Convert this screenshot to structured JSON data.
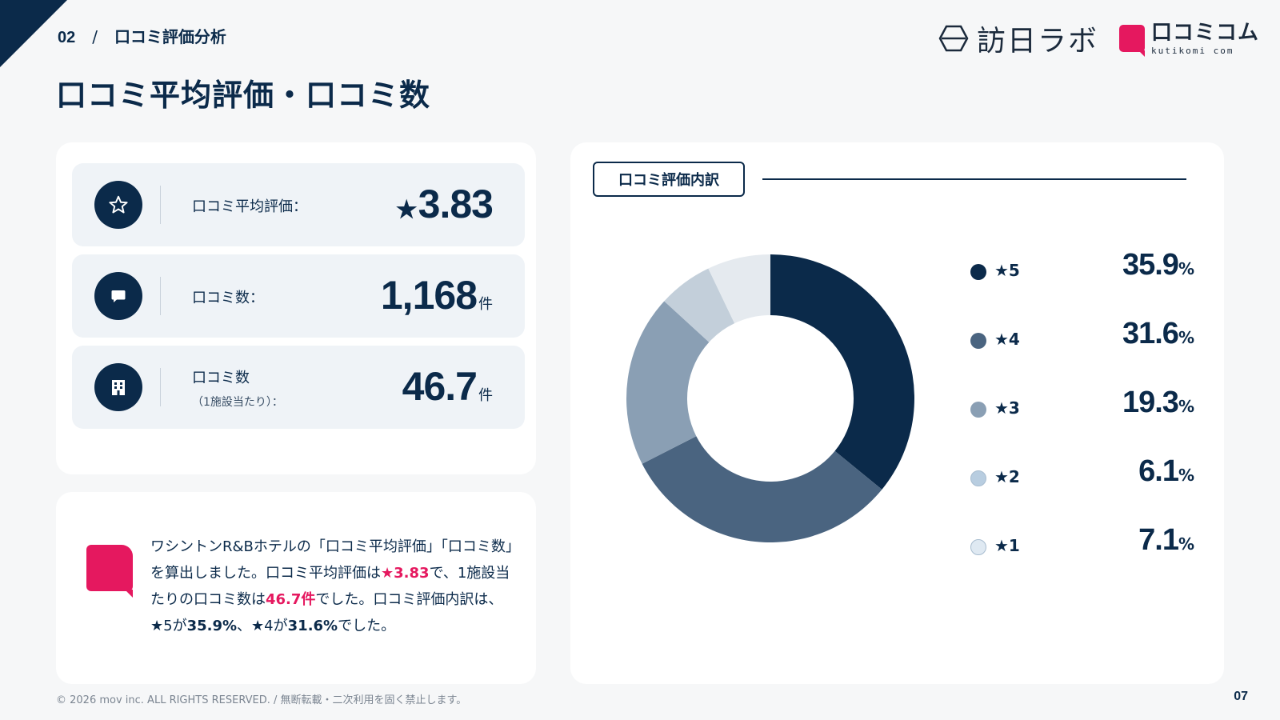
{
  "header": {
    "section_number": "02",
    "separator": "/",
    "section_title": "口コミ評価分析",
    "page_title": "口コミ平均評価・口コミ数",
    "logo1_text": "訪日ラボ",
    "logo2_text": "口コミコム",
    "logo2_sub": "kutikomi com"
  },
  "stats": [
    {
      "label": "口コミ平均評価：",
      "prefix": "★",
      "value": "3.83",
      "unit": "",
      "icon": "star-icon"
    },
    {
      "label": "口コミ数：",
      "prefix": "",
      "value": "1,168",
      "unit": "件",
      "icon": "chat-icon"
    },
    {
      "label": "口コミ数",
      "sub": "（1施設当たり）：",
      "prefix": "",
      "value": "46.7",
      "unit": "件",
      "icon": "building-icon"
    }
  ],
  "note": {
    "t1": "ワシントンR&Bホテルの「口コミ平均評価」「口コミ数」を算出しました。口コミ平均評価は",
    "h1": "★3.83",
    "t2": "で、1施設当たりの口コミ数は",
    "h2": "46.7件",
    "t3": "でした。口コミ評価内訳は、★5が",
    "b1": "35.9%",
    "t4": "、★4が",
    "b2": "31.6%",
    "t5": "でした。"
  },
  "chart_title": "口コミ評価内訳",
  "chart_data": {
    "type": "pie",
    "style": "donut",
    "categories": [
      "★5",
      "★4",
      "★3",
      "★2",
      "★1"
    ],
    "values": [
      35.9,
      31.6,
      19.3,
      6.1,
      7.1
    ],
    "unit": "%",
    "colors": [
      "#0b2a4a",
      "#4a6480",
      "#8a9fb4",
      "#c3cfda",
      "#e5eaef"
    ],
    "legend_colors": [
      "#0b2a4a",
      "#4a6480",
      "#8a9fb4",
      "#b8cde0",
      "#dfe9f2"
    ],
    "legend_position": "right",
    "start_angle": "top, clockwise"
  },
  "footer": {
    "copyright": "© 2026 mov inc. ALL RIGHTS RESERVED. / 無断転載・二次利用を固く禁止します。",
    "page_number": "07"
  }
}
